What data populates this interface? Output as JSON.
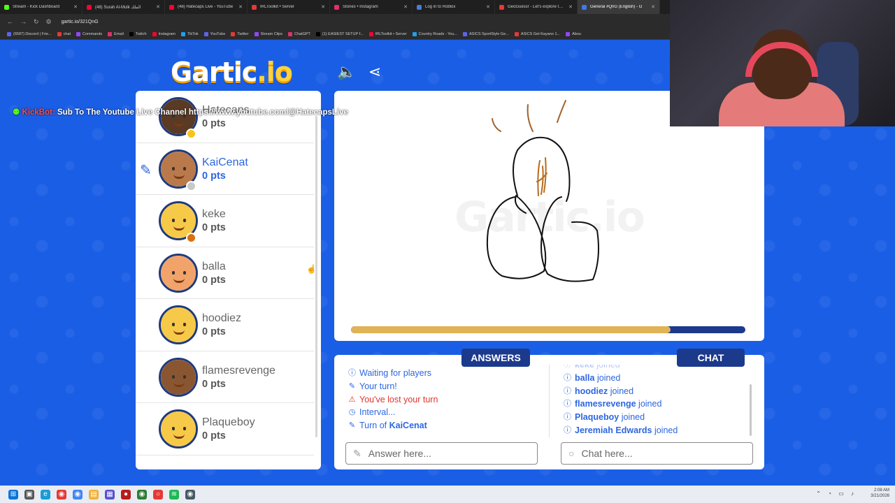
{
  "browser": {
    "tabs": [
      {
        "label": "Stream - Kick Dashboard",
        "color": "#53fc18"
      },
      {
        "label": "(48) Surah Al-Mulk الملك",
        "color": "#ff0033"
      },
      {
        "label": "(48) Hatecaps Live - YouTube",
        "color": "#ff0033"
      },
      {
        "label": "IRLToolkit • Server",
        "color": "#e53935"
      },
      {
        "label": "Stories • Instagram",
        "color": "#e1306c"
      },
      {
        "label": "Log in to Roblox",
        "color": "#4a7bd8"
      },
      {
        "label": "GeoGuessr - Let's explore the w",
        "color": "#e53935"
      },
      {
        "label": "General #QnG (English) - G",
        "color": "#3d7be3"
      }
    ],
    "url": "gartic.io/321QnG",
    "bookmarks": [
      "(6587) Discord | Frie...",
      "chat",
      "Commands",
      "Email",
      "Twitch",
      "Instagram",
      "TikTok",
      "YouTube",
      "Twitter",
      "Stream Clips",
      "ChatGPT",
      "(1) EASIEST SETUP f...",
      "IRLToolkit • Server",
      "Country Roads - You...",
      "ASICS SportStyle Ge...",
      "ASICS Gel-Kayano 1...",
      "Abou"
    ]
  },
  "logo": {
    "main": "Gartic",
    "suffix": ".io"
  },
  "kickbot": {
    "name": "KickBot:",
    "message": "Sub To The Youtube Live Channel https://www.youtube.com/@HatecapsLive"
  },
  "players": [
    {
      "name": "Hatecaps",
      "points": "0 pts",
      "skin": "#5a3a24",
      "status": "#f5c518",
      "drawing": false
    },
    {
      "name": "KaiCenat",
      "points": "0 pts",
      "skin": "#b9794b",
      "status": "#c8c8c8",
      "drawing": true
    },
    {
      "name": "keke",
      "points": "0 pts",
      "skin": "#f7c948",
      "status": "#d9700c",
      "drawing": false
    },
    {
      "name": "balla",
      "points": "0 pts",
      "skin": "#f2a36a",
      "status": "",
      "drawing": false
    },
    {
      "name": "hoodiez",
      "points": "0 pts",
      "skin": "#f7c948",
      "status": "",
      "drawing": false
    },
    {
      "name": "flamesrevenge",
      "points": "0 pts",
      "skin": "#8a5632",
      "status": "",
      "drawing": false
    },
    {
      "name": "Plaqueboy",
      "points": "0 pts",
      "skin": "#f7c948",
      "status": "",
      "drawing": false
    }
  ],
  "canvas": {
    "watermark": "Gartic.io",
    "timer_fraction": 0.81
  },
  "answers": {
    "tab_label": "ANSWERS",
    "log": [
      {
        "icon": "info-icon",
        "text": "Waiting for players",
        "tone": "blue"
      },
      {
        "icon": "pencil-icon",
        "text": "Your turn!",
        "tone": "blue"
      },
      {
        "icon": "warning-icon",
        "text": "You've lost your turn",
        "tone": "red"
      },
      {
        "icon": "clock-icon",
        "text": "Interval...",
        "tone": "blue"
      },
      {
        "icon": "pencil-icon",
        "text": "Turn of ",
        "name": "KaiCenat",
        "tone": "blue"
      }
    ],
    "placeholder": "Answer here..."
  },
  "chat": {
    "tab_label": "CHAT",
    "log": [
      {
        "name": "keke",
        "text": "joined"
      },
      {
        "name": "balla",
        "text": "joined"
      },
      {
        "name": "hoodiez",
        "text": "joined"
      },
      {
        "name": "flamesrevenge",
        "text": "joined"
      },
      {
        "name": "Plaqueboy",
        "text": "joined"
      },
      {
        "name": "Jeremiah Edwards",
        "text": "joined"
      }
    ],
    "placeholder": "Chat here..."
  },
  "taskbar": {
    "time": "2:08 AM",
    "date": "3/21/2026"
  }
}
